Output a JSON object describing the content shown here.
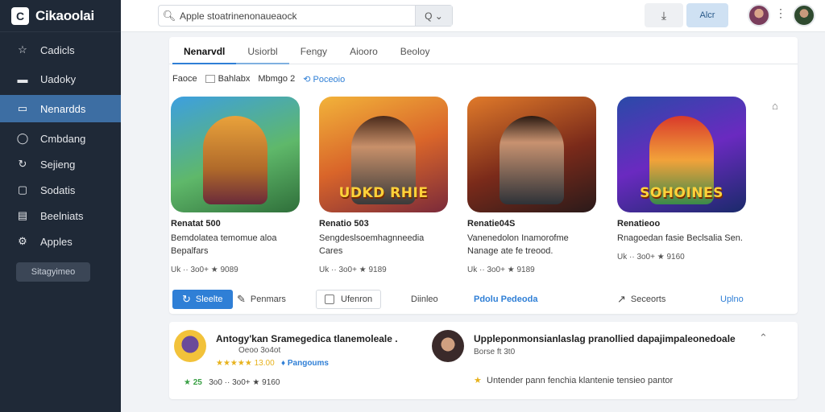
{
  "app": {
    "name": "Cikaoolai",
    "logo_glyph": "C"
  },
  "sidebar": {
    "items": [
      {
        "label": "Cadicls",
        "icon": "star-icon"
      },
      {
        "label": "Uadoky",
        "icon": "folder-icon"
      },
      {
        "label": "Nenardds",
        "icon": "grid-icon"
      },
      {
        "label": "Cmbdang",
        "icon": "circle-icon"
      },
      {
        "label": "Sejieng",
        "icon": "refresh-icon"
      },
      {
        "label": "Sodatis",
        "icon": "card-icon"
      },
      {
        "label": "Beelniats",
        "icon": "list-icon"
      },
      {
        "label": "Apples",
        "icon": "gear-icon"
      }
    ],
    "active_index": 2,
    "bottom_button": "Sitagyimeo"
  },
  "topbar": {
    "search_value": "Apple stoatrinenonaueaock",
    "search_button": "Q ⌄",
    "primary_button": "Alcr",
    "icon_button": "⤓"
  },
  "tabs": [
    "Nenarvdl",
    "Usiorbl",
    "Fengy",
    "Aiooro",
    "Beoloy"
  ],
  "filters": {
    "label": "Faoce",
    "option1": "Bahlabx",
    "option2": "Mbmgo 2",
    "link": "Poceoio"
  },
  "games": [
    {
      "title": "Renatat 500",
      "desc": "Bemdolatea temomue aloa Bepalfars",
      "rating": "Uk ·· 3o0+ ★ 9089",
      "art_text": ""
    },
    {
      "title": "Renatio 503",
      "desc": "Sengdeslsoemhagnneedia Cares",
      "rating": "Uk ·· 3o0+ ★ 9189",
      "art_text": "UDKD RHIE"
    },
    {
      "title": "Renatie04S",
      "desc": "Vanenedolon Inamorofme Nanage ate fe treood.",
      "rating": "Uk ·· 3o0+ ★ 9189",
      "art_text": ""
    },
    {
      "title": "Renatieoo",
      "desc": "Rnagoedan fasie Beclsalia Sen.",
      "rating": "Uk ·· 3o0+ ★ 9160",
      "art_text": "SOHOINES"
    }
  ],
  "actions": {
    "primary": "Sleelte",
    "share": "Penmars",
    "checkbox": "Ufenron",
    "plain": "Diinleo",
    "link1": "Pdolu Pedeoda",
    "other": "Seceorts",
    "link2": "Uplno"
  },
  "reviews": [
    {
      "title": "Antogy'kan Sramegedica tlanemoleale .",
      "sub": "Oeoo 3o4ot",
      "line1": "★★★★★ 13.00",
      "line1_link": "Pangoums",
      "line2": "25",
      "line2_rest": "3o0 ·· 3o0+ ★ 9160"
    },
    {
      "title": "Uppleponmonsianlaslag pranollied dapajimpaleonedoale",
      "sub": "Borse ft 3t0",
      "line2": "Untender pann fenchia klantenie tensieo pantor"
    }
  ],
  "colors": {
    "accent": "#2f7fd6",
    "sidebar": "#1f2937",
    "sidebar_active": "#3d6ea3",
    "star": "#e7b21d"
  }
}
